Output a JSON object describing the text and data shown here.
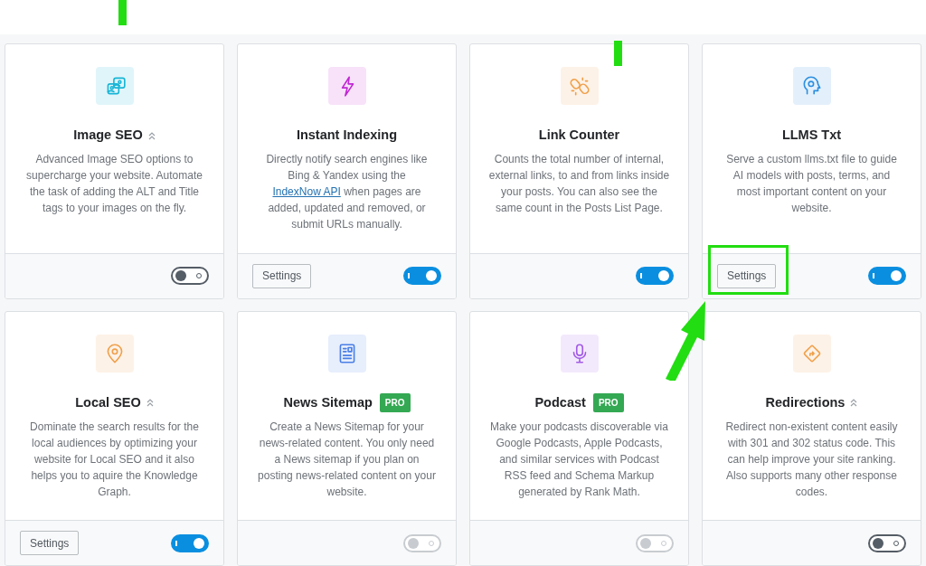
{
  "modules": [
    {
      "title": "Image SEO",
      "advanced": true,
      "color": "#17b5d6",
      "description": [
        {
          "text": "Advanced Image SEO options to supercharge your website. Automate the task of adding the ALT and Title tags to your images on the fly."
        }
      ],
      "toggle": {
        "on": false,
        "disabled": false
      }
    },
    {
      "title": "Instant Indexing",
      "color": "#c026d3",
      "description": [
        {
          "text": "Directly notify search engines like Bing & Yandex using the "
        },
        {
          "text": "IndexNow API",
          "kind": "link"
        },
        {
          "text": " when pages are added, updated and removed, or submit URLs manually."
        }
      ],
      "settings_button": "Settings",
      "toggle": {
        "on": true,
        "disabled": false
      }
    },
    {
      "title": "Link Counter",
      "color": "#f0a04b",
      "description": [
        {
          "text": "Counts the total number of internal, external links, to and from links inside your posts. You can also see the same count in the Posts List Page."
        }
      ],
      "toggle": {
        "on": true,
        "disabled": false
      }
    },
    {
      "title": "LLMS Txt",
      "color": "#2d8fe0",
      "description": [
        {
          "text": "Serve a custom llms.txt file to guide AI models with posts, terms, and most important content on your website."
        }
      ],
      "settings_button": "Settings",
      "toggle": {
        "on": true,
        "disabled": false
      }
    },
    {
      "title": "Local SEO",
      "advanced": true,
      "color": "#f0a04b",
      "description": [
        {
          "text": "Dominate the search results for the local audiences by optimizing your website for Local SEO and it also helps you to aquire the Knowledge Graph."
        }
      ],
      "settings_button": "Settings",
      "toggle": {
        "on": true,
        "disabled": false
      }
    },
    {
      "title": "News Sitemap",
      "badge": "PRO",
      "color": "#4a7fe6",
      "description": [
        {
          "text": "Create a News Sitemap for your news-related content. You only need a News sitemap if you plan on posting news-related content on your website."
        }
      ],
      "toggle": {
        "on": false,
        "disabled": true
      }
    },
    {
      "title": "Podcast",
      "badge": "PRO",
      "color": "#a25be6",
      "description": [
        {
          "text": "Make your podcasts discoverable via Google Podcasts, Apple Podcasts, and similar services with Podcast RSS feed and Schema Markup generated by Rank Math."
        }
      ],
      "toggle": {
        "on": false,
        "disabled": true
      }
    },
    {
      "title": "Redirections",
      "advanced": true,
      "color": "#f0a04b",
      "description": [
        {
          "text": "Redirect non-existent content easily with 301 and 302 status code. This can help improve your site ranking. Also supports many other response codes."
        }
      ],
      "toggle": {
        "on": false,
        "disabled": false
      }
    }
  ]
}
